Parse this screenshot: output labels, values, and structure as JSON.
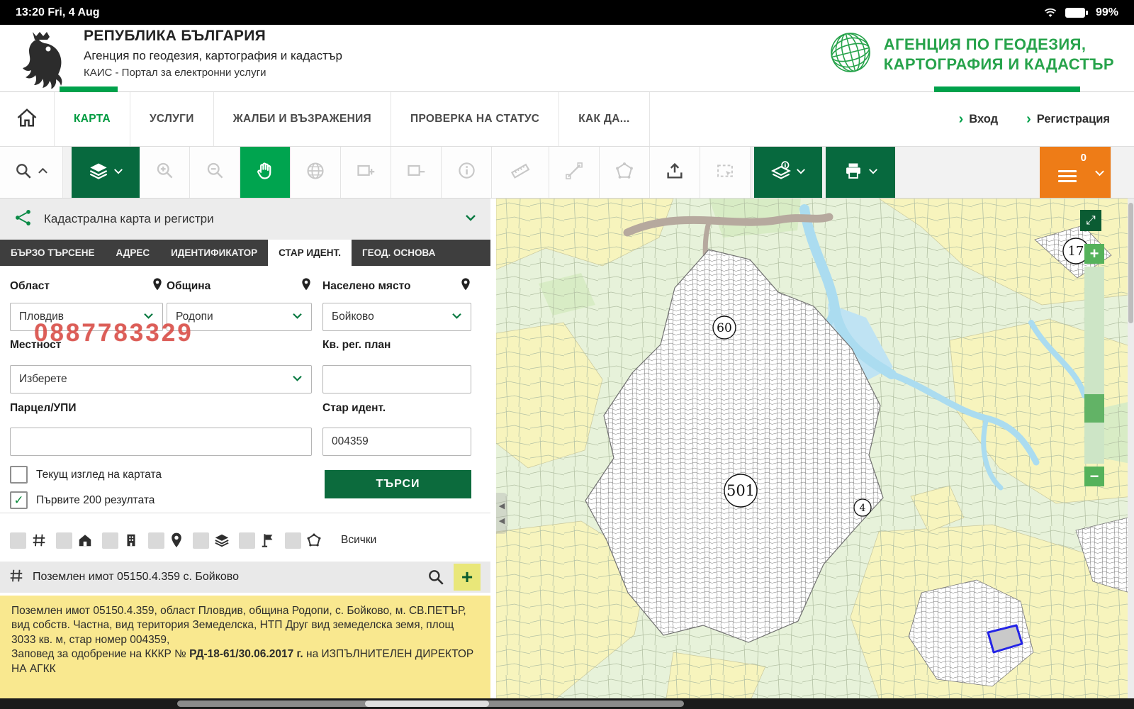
{
  "status_bar": {
    "time": "13:20 Fri, 4 Aug",
    "battery": "99%"
  },
  "header": {
    "republic": "РЕПУБЛИКА БЪЛГАРИЯ",
    "agency": "Агенция по геодезия, картография и кадастър",
    "portal": "КАИС - Портал за електронни услуги",
    "logo_line1": "АГЕНЦИЯ ПО ГЕОДЕЗИЯ,",
    "logo_line2": "КАРТОГРАФИЯ И КАДАСТЪР"
  },
  "nav": {
    "items": [
      {
        "label": "КАРТА"
      },
      {
        "label": "УСЛУГИ"
      },
      {
        "label": "ЖАЛБИ И ВЪЗРАЖЕНИЯ"
      },
      {
        "label": "ПРОВЕРКА НА СТАТУС"
      },
      {
        "label": "КАК ДА..."
      }
    ],
    "login": "Вход",
    "register": "Регистрация"
  },
  "toolbar": {
    "cart_count": "0"
  },
  "panel": {
    "layer_selector": "Кадастрална карта и регистри",
    "tabs": [
      {
        "label": "БЪРЗО ТЪРСЕНЕ"
      },
      {
        "label": "АДРЕС"
      },
      {
        "label": "ИДЕНТИФИКАТОР"
      },
      {
        "label": "СТАР ИДЕНТ."
      },
      {
        "label": "ГЕОД. ОСНОВА"
      }
    ],
    "form": {
      "oblast_label": "Област",
      "oblast_value": "Пловдив",
      "obshtina_label": "Община",
      "obshtina_value": "Родопи",
      "naseleno_label": "Населено място",
      "naseleno_value": "Бойково",
      "mestnost_label": "Местност",
      "mestnost_value": "Изберете",
      "kvartal_label": "Кв. рег. план",
      "parcel_label": "Парцел/УПИ",
      "star_ident_label": "Стар идент.",
      "star_ident_value": "004359",
      "checkbox_current_view": "Текущ изглед на картата",
      "checkbox_first_200": "Първите 200 резултата",
      "search_button": "ТЪРСИ"
    },
    "watermark": "0887783329",
    "filters_all": "Всички",
    "result": {
      "title": "Поземлен имот 05150.4.359 с. Бойково",
      "details_line1": "Поземлен имот 05150.4.359, област Пловдив, община Родопи, с. Бойково, м. СВ.ПЕТЪР, вид собств. Частна, вид територия Земеделска, НТП Друг вид земеделска земя, площ 3033 кв. м, стар номер 004359,",
      "details_order_prefix": "Заповед за одобрение на КККР № ",
      "details_order_number": "РД-18-61/30.06.2017 г.",
      "details_order_suffix": " на ИЗПЪЛНИТЕЛЕН ДИРЕКТОР НА АГКК"
    }
  },
  "map": {
    "markers": [
      {
        "label": "60"
      },
      {
        "label": "501"
      },
      {
        "label": "4"
      },
      {
        "label": "17"
      }
    ],
    "zoom_in": "+",
    "zoom_out": "−"
  },
  "icons": {
    "expand": "⤢",
    "collapse": "◀",
    "nav_arrow": "›",
    "check": "✓"
  },
  "colors": {
    "brand_green_dark": "#07693e",
    "brand_green": "#00a44f",
    "accent_orange": "#ee7c17",
    "result_yellow": "#f9e88f",
    "watermark_red": "#d84c46"
  }
}
